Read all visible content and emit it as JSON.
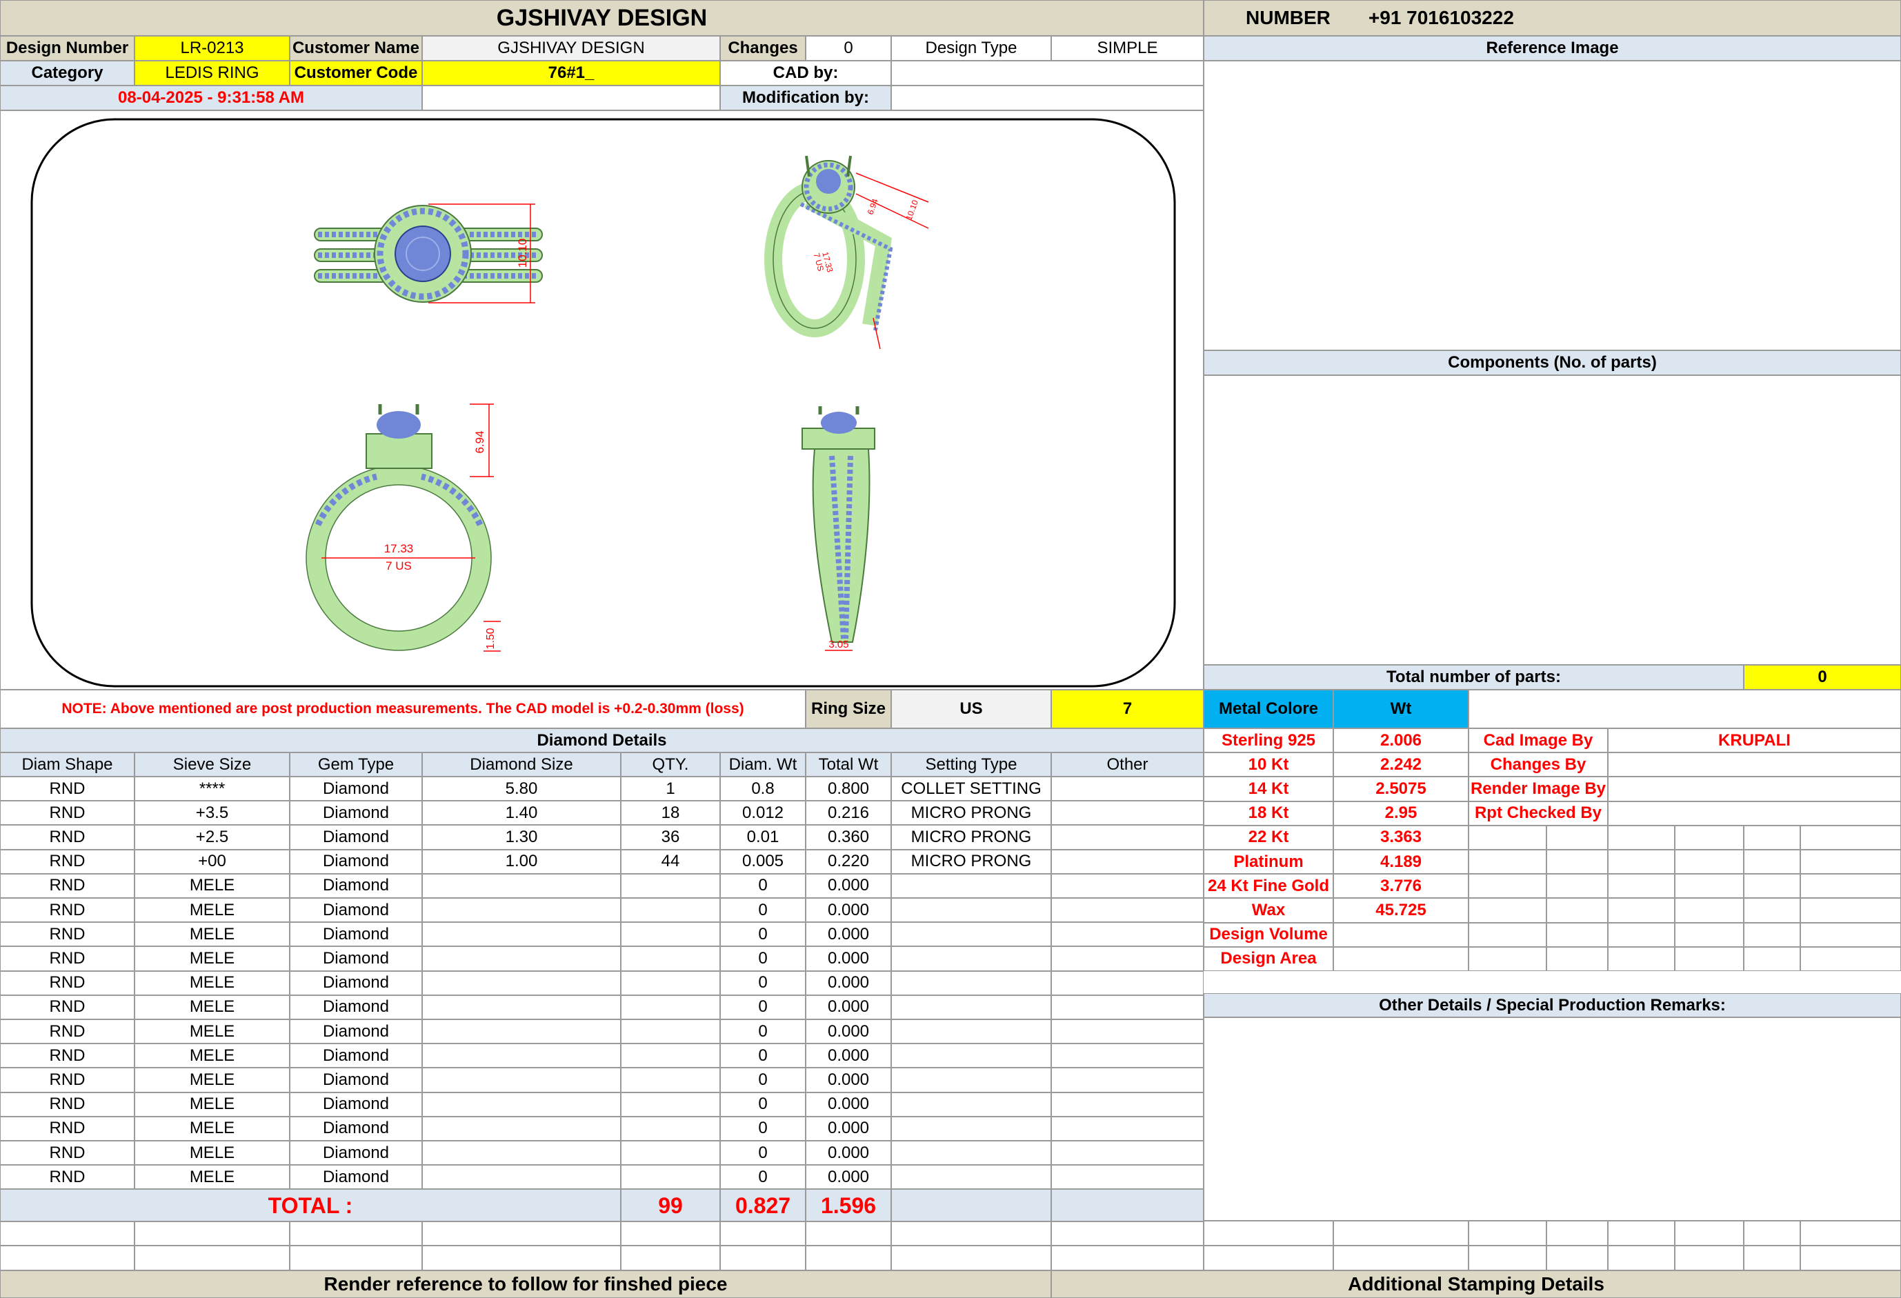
{
  "header": {
    "title": "GJSHIVAY DESIGN",
    "number_label": "NUMBER",
    "number_value": "+91 7016103222"
  },
  "info": {
    "design_number_label": "Design Number",
    "design_number": "LR-0213",
    "customer_name_label": "Customer Name",
    "customer_name": "GJSHIVAY DESIGN",
    "changes_label": "Changes",
    "changes": "0",
    "design_type_label": "Design Type",
    "design_type": "SIMPLE",
    "category_label": "Category",
    "category": "LEDIS RING",
    "customer_code_label": "Customer Code",
    "customer_code": "76#1_",
    "cad_by_label": "CAD by:",
    "modification_by_label": "Modification by:",
    "timestamp": "08-04-2025 - 9:31:58 AM"
  },
  "drawing": {
    "dims": [
      "10.10",
      "6.94",
      "17.33",
      "7 US",
      "1.50",
      "3.05",
      "6.94",
      "17.33",
      "7 US",
      "10.10"
    ]
  },
  "right_panel": {
    "reference_image": "Reference Image",
    "components": "Components (No. of parts)",
    "total_parts_label": "Total number of parts:",
    "total_parts": "0",
    "other_details": "Other Details / Special Production Remarks:"
  },
  "note": {
    "text": "NOTE: Above mentioned are post production measurements. The CAD model is +0.2-0.30mm (loss)",
    "ring_size_label": "Ring Size",
    "ring_size_unit": "US",
    "ring_size": "7"
  },
  "metal": {
    "colore_label": "Metal Colore",
    "wt_label": "Wt",
    "rows": [
      {
        "name": "Sterling 925",
        "wt": "2.006"
      },
      {
        "name": "10 Kt",
        "wt": "2.242"
      },
      {
        "name": "14 Kt",
        "wt": "2.5075"
      },
      {
        "name": "18 Kt",
        "wt": "2.95"
      },
      {
        "name": "22 Kt",
        "wt": "3.363"
      },
      {
        "name": "Platinum",
        "wt": "4.189"
      },
      {
        "name": "24 Kt Fine Gold",
        "wt": "3.776"
      },
      {
        "name": "Wax",
        "wt": "45.725"
      },
      {
        "name": "Design Volume",
        "wt": ""
      },
      {
        "name": "Design Area",
        "wt": ""
      }
    ],
    "credits": [
      {
        "label": "Cad Image By",
        "value": "KRUPALI"
      },
      {
        "label": "Changes By",
        "value": ""
      },
      {
        "label": "Render Image By",
        "value": ""
      },
      {
        "label": "Rpt Checked By",
        "value": ""
      }
    ]
  },
  "diamond": {
    "title": "Diamond Details",
    "headers": [
      "Diam Shape",
      "Sieve Size",
      "Gem Type",
      "Diamond Size",
      "QTY.",
      "Diam. Wt",
      "Total Wt",
      "Setting Type",
      "Other"
    ],
    "rows": [
      [
        "RND",
        "****",
        "Diamond",
        "5.80",
        "1",
        "0.8",
        "0.800",
        "COLLET SETTING",
        ""
      ],
      [
        "RND",
        "+3.5",
        "Diamond",
        "1.40",
        "18",
        "0.012",
        "0.216",
        "MICRO PRONG",
        ""
      ],
      [
        "RND",
        "+2.5",
        "Diamond",
        "1.30",
        "36",
        "0.01",
        "0.360",
        "MICRO PRONG",
        ""
      ],
      [
        "RND",
        "+00",
        "Diamond",
        "1.00",
        "44",
        "0.005",
        "0.220",
        "MICRO PRONG",
        ""
      ],
      [
        "RND",
        "MELE",
        "Diamond",
        "",
        "",
        "0",
        "0.000",
        "",
        ""
      ],
      [
        "RND",
        "MELE",
        "Diamond",
        "",
        "",
        "0",
        "0.000",
        "",
        ""
      ],
      [
        "RND",
        "MELE",
        "Diamond",
        "",
        "",
        "0",
        "0.000",
        "",
        ""
      ],
      [
        "RND",
        "MELE",
        "Diamond",
        "",
        "",
        "0",
        "0.000",
        "",
        ""
      ],
      [
        "RND",
        "MELE",
        "Diamond",
        "",
        "",
        "0",
        "0.000",
        "",
        ""
      ],
      [
        "RND",
        "MELE",
        "Diamond",
        "",
        "",
        "0",
        "0.000",
        "",
        ""
      ],
      [
        "RND",
        "MELE",
        "Diamond",
        "",
        "",
        "0",
        "0.000",
        "",
        ""
      ],
      [
        "RND",
        "MELE",
        "Diamond",
        "",
        "",
        "0",
        "0.000",
        "",
        ""
      ],
      [
        "RND",
        "MELE",
        "Diamond",
        "",
        "",
        "0",
        "0.000",
        "",
        ""
      ],
      [
        "RND",
        "MELE",
        "Diamond",
        "",
        "",
        "0",
        "0.000",
        "",
        ""
      ],
      [
        "RND",
        "MELE",
        "Diamond",
        "",
        "",
        "0",
        "0.000",
        "",
        ""
      ],
      [
        "RND",
        "MELE",
        "Diamond",
        "",
        "",
        "0",
        "0.000",
        "",
        ""
      ],
      [
        "RND",
        "MELE",
        "Diamond",
        "",
        "",
        "0",
        "0.000",
        "",
        ""
      ]
    ],
    "total_label": "TOTAL :",
    "total_qty": "99",
    "total_diam_wt": "0.827",
    "total_wt": "1.596"
  },
  "footer": {
    "render_reference": "Render reference to follow for finshed piece",
    "stamping": "Additional Stamping Details"
  },
  "colors": {
    "tan": "#ddd9c4",
    "light_blue": "#dce6f1",
    "yellow": "#ffff00",
    "cyan": "#00b0f0",
    "red": "#ff0000",
    "metal_green": "#b7e4a0",
    "stone_blue": "#6f87d6"
  }
}
